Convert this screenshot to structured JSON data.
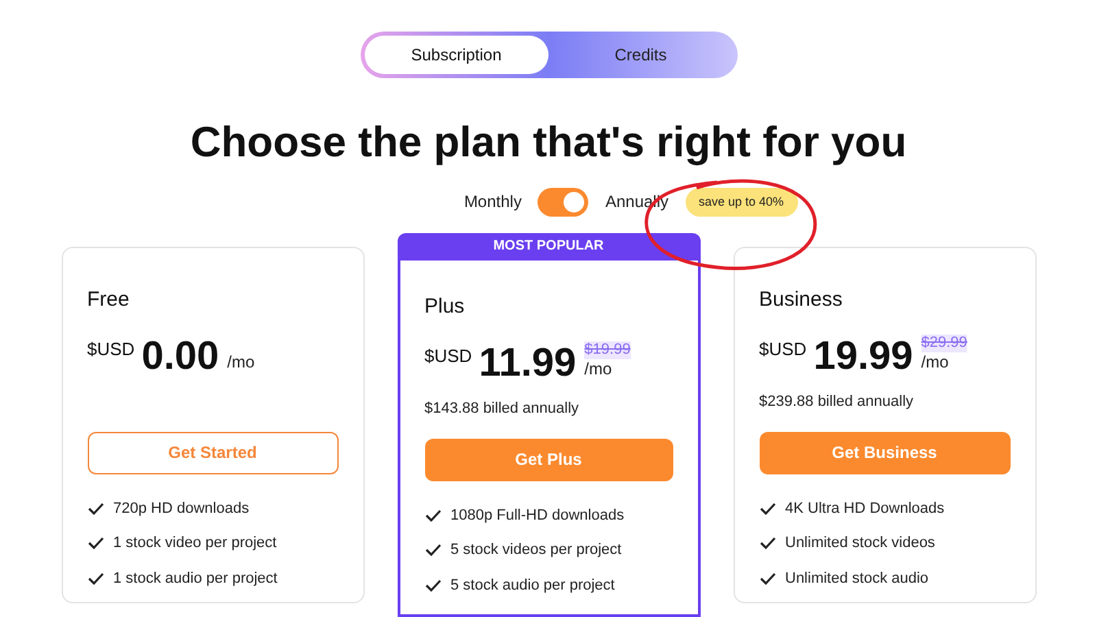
{
  "tabs": [
    {
      "label": "Subscription",
      "selected": true
    },
    {
      "label": "Credits",
      "selected": false
    }
  ],
  "heading": "Choose the plan that's right for you",
  "billing": {
    "monthly_label": "Monthly",
    "annual_label": "Annually",
    "on": true,
    "badge": "save up to 40%"
  },
  "plans": [
    {
      "name": "Free",
      "featured": false,
      "currency": "$USD",
      "price": "0.00",
      "period": "/mo",
      "button": {
        "label": "Get Started",
        "kind": "outline"
      },
      "features": [
        "720p HD downloads",
        "1 stock video per project",
        "1 stock audio per project"
      ]
    },
    {
      "name": "Plus",
      "featured": true,
      "ribbon": "MOST POPULAR",
      "currency": "$USD",
      "price": "11.99",
      "old_price": "$19.99",
      "period": "/mo",
      "billed": "$143.88 billed annually",
      "button": {
        "label": "Get Plus",
        "kind": "filled"
      },
      "features": [
        "1080p Full-HD downloads",
        "5 stock videos per project",
        "5 stock audio per project"
      ]
    },
    {
      "name": "Business",
      "featured": false,
      "currency": "$USD",
      "price": "19.99",
      "old_price": "$29.99",
      "period": "/mo",
      "billed": "$239.88 billed annually",
      "button": {
        "label": "Get Business",
        "kind": "filled"
      },
      "features": [
        "4K Ultra HD Downloads",
        "Unlimited stock videos",
        "Unlimited stock audio"
      ]
    }
  ]
}
